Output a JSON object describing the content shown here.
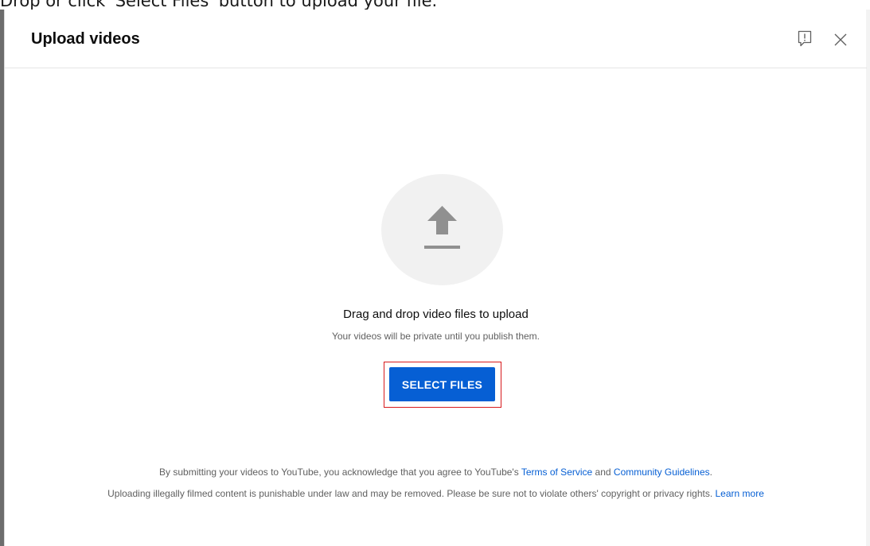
{
  "instruction": "Drop or click 'Select Files' button to upload your file.",
  "dialog": {
    "title": "Upload videos",
    "icons": {
      "feedback": "feedback-icon",
      "close": "close-icon",
      "upload": "upload-arrow-icon"
    }
  },
  "dropzone": {
    "main_text": "Drag and drop video files to upload",
    "sub_text": "Your videos will be private until you publish them.",
    "button_label": "SELECT FILES"
  },
  "footer": {
    "line1_prefix": "By submitting your videos to YouTube, you acknowledge that you agree to YouTube's ",
    "terms_link": "Terms of Service",
    "line1_and": " and ",
    "guidelines_link": "Community Guidelines",
    "line1_suffix": ".",
    "line2_text": "Uploading illegally filmed content is punishable under law and may be removed. Please be sure not to violate others' copyright or privacy rights. ",
    "learn_more_link": "Learn more"
  },
  "colors": {
    "accent": "#065fd4",
    "highlight": "#d7191c",
    "circle": "#f1f1f1",
    "icon": "#909090"
  }
}
